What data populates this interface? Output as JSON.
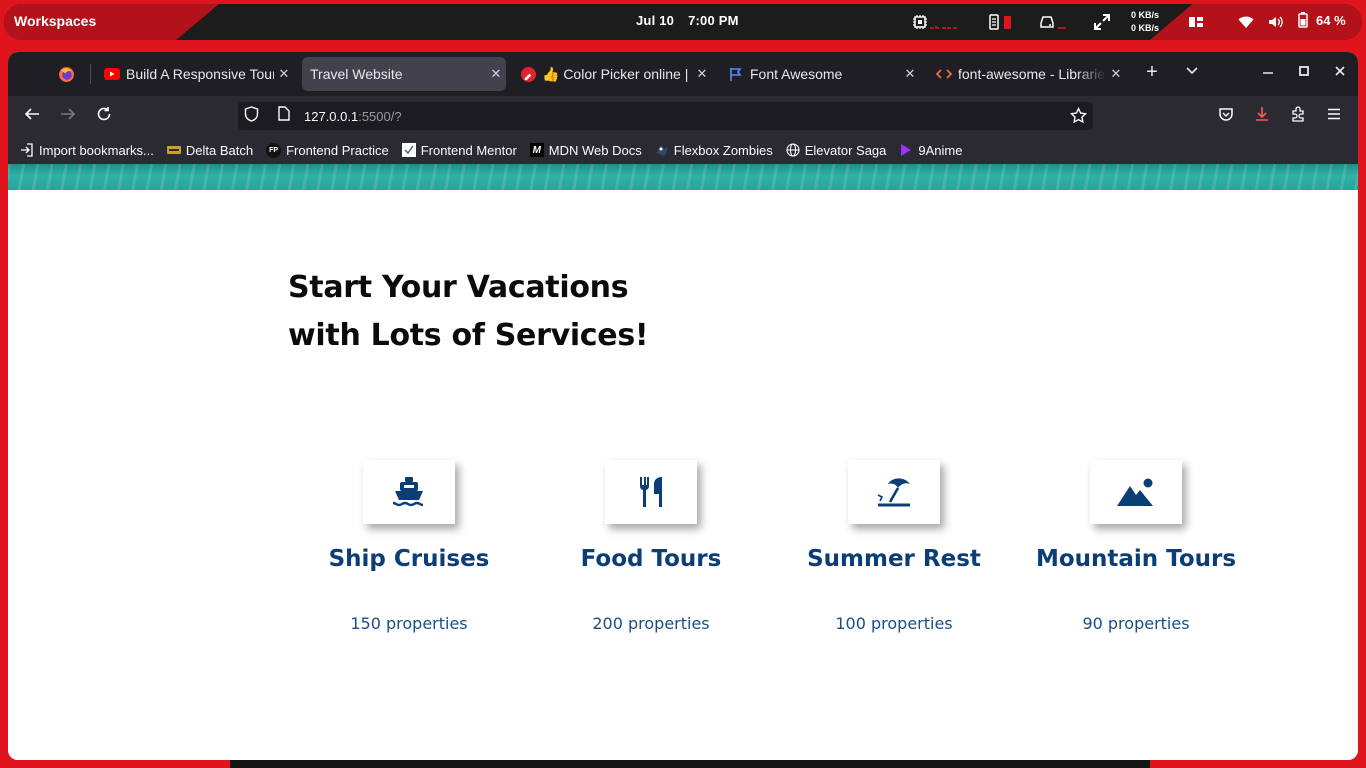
{
  "desktop": {
    "workspaces_label": "Workspaces",
    "date": "Jul 10",
    "time": "7:00 PM",
    "net_up": "0 KB/s",
    "net_down": "0 KB/s",
    "battery": "64 %"
  },
  "tabs": [
    {
      "title": "Build A Responsive Tour",
      "favicon": "youtube-icon"
    },
    {
      "title": "Travel Website",
      "favicon": "none",
      "active": true
    },
    {
      "title": "👍 Color Picker online | H",
      "favicon": "color-picker-icon"
    },
    {
      "title": "Font Awesome",
      "favicon": "flag-icon"
    },
    {
      "title": "font-awesome - Libraries",
      "favicon": "code-icon"
    }
  ],
  "urlbar": {
    "host": "127.0.0.1",
    "path": ":5500/?"
  },
  "bookmarks": [
    {
      "label": "Import bookmarks...",
      "icon": "import-icon"
    },
    {
      "label": "Delta Batch",
      "icon": "delta-icon"
    },
    {
      "label": "Frontend Practice",
      "icon": "fp-icon"
    },
    {
      "label": "Frontend Mentor",
      "icon": "fm-icon"
    },
    {
      "label": "MDN Web Docs",
      "icon": "mdn-icon"
    },
    {
      "label": "Flexbox Zombies",
      "icon": "zombie-icon"
    },
    {
      "label": "Elevator Saga",
      "icon": "globe-icon"
    },
    {
      "label": "9Anime",
      "icon": "play-icon"
    }
  ],
  "page": {
    "headline_line1": "Start Your Vacations",
    "headline_line2": "with Lots of Services!",
    "services": [
      {
        "name": "Ship Cruises",
        "props": "150 properties",
        "icon": "ship-icon"
      },
      {
        "name": "Food Tours",
        "props": "200 properties",
        "icon": "utensils-icon"
      },
      {
        "name": "Summer Rest",
        "props": "100 properties",
        "icon": "umbrella-beach-icon"
      },
      {
        "name": "Mountain Tours",
        "props": "90 properties",
        "icon": "mountain-sun-icon"
      }
    ]
  },
  "colors": {
    "accent": "#0b3d77",
    "panel": "#e0141c",
    "tabstrip": "#1f1e25",
    "toolbar": "#2b2a33"
  }
}
